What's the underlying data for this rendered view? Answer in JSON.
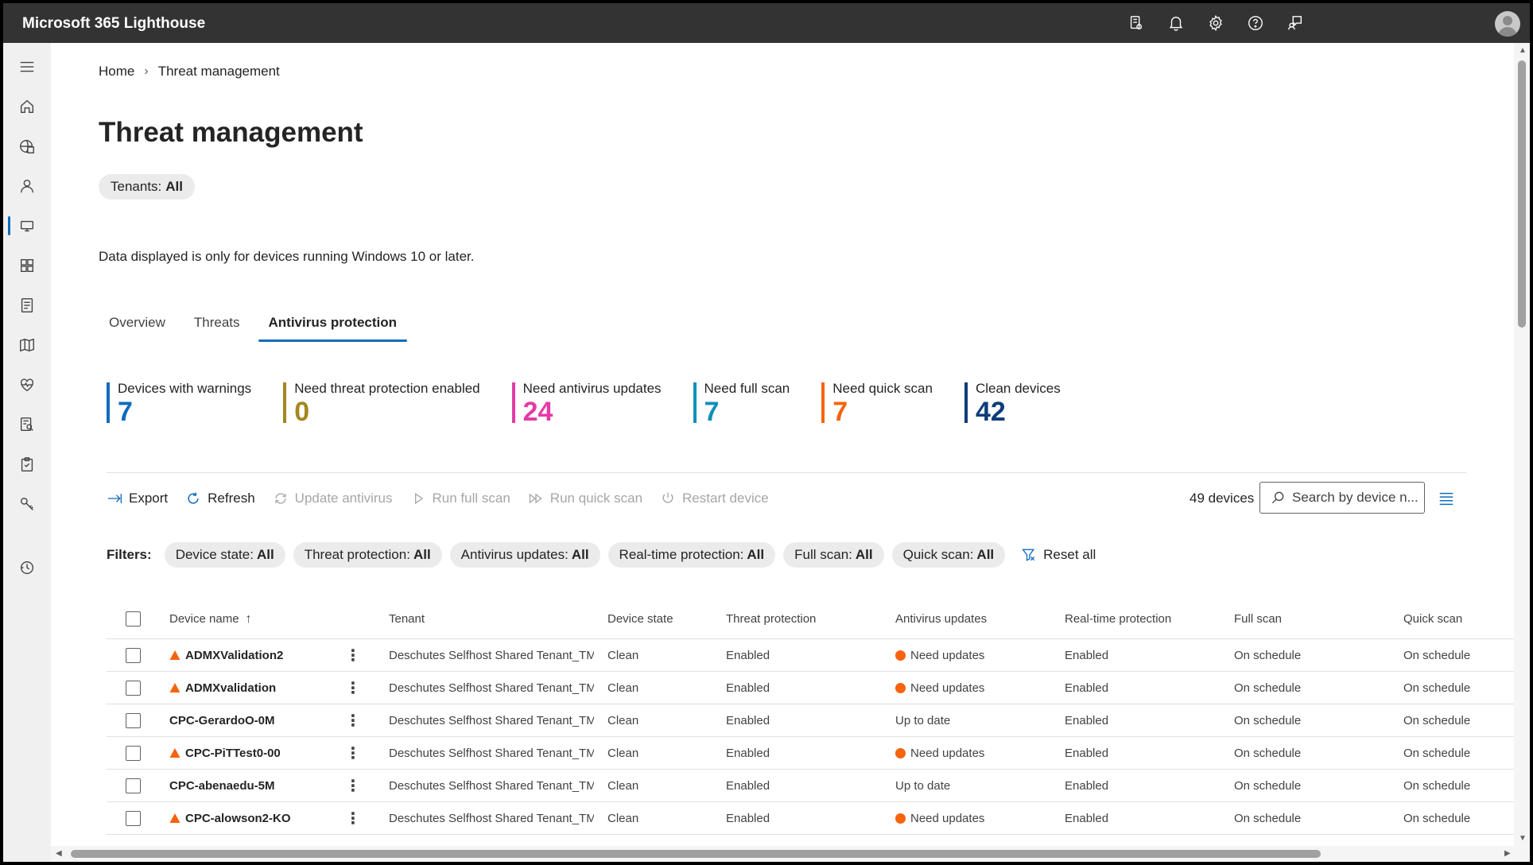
{
  "app": {
    "title": "Microsoft 365 Lighthouse"
  },
  "topbar_icons": [
    "setup-icon",
    "bell-icon",
    "gear-icon",
    "help-icon",
    "feedback-icon"
  ],
  "nav_icons": [
    "hamburger-icon",
    "home-icon",
    "tenants-icon",
    "users-icon",
    "devices-icon",
    "apps-icon",
    "policy-icon",
    "map-icon",
    "health-icon",
    "audit-icon",
    "clipboard-icon",
    "key-icon",
    "history-icon"
  ],
  "breadcrumb": {
    "home": "Home",
    "current": "Threat management"
  },
  "page": {
    "title": "Threat management",
    "tenant_label": "Tenants:",
    "tenant_value": "All",
    "notice": "Data displayed is only for devices running Windows 10 or later."
  },
  "tabs": [
    {
      "label": "Overview"
    },
    {
      "label": "Threats"
    },
    {
      "label": "Antivirus protection"
    }
  ],
  "kpis": [
    {
      "label": "Devices with warnings",
      "value": "7",
      "color": "#0f6cbd"
    },
    {
      "label": "Need threat protection enabled",
      "value": "0",
      "color": "#a4881f"
    },
    {
      "label": "Need antivirus updates",
      "value": "24",
      "color": "#e43ba6"
    },
    {
      "label": "Need full scan",
      "value": "7",
      "color": "#0f8fb8"
    },
    {
      "label": "Need quick scan",
      "value": "7",
      "color": "#f7630c"
    },
    {
      "label": "Clean devices",
      "value": "42",
      "color": "#0b3d7a"
    }
  ],
  "toolbar": {
    "export": "Export",
    "refresh": "Refresh",
    "update_antivirus": "Update antivirus",
    "run_full_scan": "Run full scan",
    "run_quick_scan": "Run quick scan",
    "restart_device": "Restart device",
    "device_count": "49 devices",
    "search_placeholder": "Search by device n..."
  },
  "filters": {
    "label": "Filters:",
    "items": [
      {
        "name": "Device state:",
        "value": "All"
      },
      {
        "name": "Threat protection:",
        "value": "All"
      },
      {
        "name": "Antivirus updates:",
        "value": "All"
      },
      {
        "name": "Real-time protection:",
        "value": "All"
      },
      {
        "name": "Full scan:",
        "value": "All"
      },
      {
        "name": "Quick scan:",
        "value": "All"
      }
    ],
    "reset": "Reset all"
  },
  "table": {
    "headers": {
      "device_name": "Device name",
      "tenant": "Tenant",
      "device_state": "Device state",
      "threat_protection": "Threat protection",
      "antivirus_updates": "Antivirus updates",
      "realtime": "Real-time protection",
      "full_scan": "Full scan",
      "quick_scan": "Quick scan"
    },
    "rows": [
      {
        "name": "ADMXValidation2",
        "warn": true,
        "tenant": "Deschutes Selfhost Shared Tenant_TM :",
        "state": "Clean",
        "threat": "Enabled",
        "av": "Need updates",
        "av_warn": true,
        "rt": "Enabled",
        "full": "On schedule",
        "quick": "On schedule"
      },
      {
        "name": "ADMXvalidation",
        "warn": true,
        "tenant": "Deschutes Selfhost Shared Tenant_TM :",
        "state": "Clean",
        "threat": "Enabled",
        "av": "Need updates",
        "av_warn": true,
        "rt": "Enabled",
        "full": "On schedule",
        "quick": "On schedule"
      },
      {
        "name": "CPC-GerardoO-0M",
        "warn": false,
        "tenant": "Deschutes Selfhost Shared Tenant_TM :",
        "state": "Clean",
        "threat": "Enabled",
        "av": "Up to date",
        "av_warn": false,
        "rt": "Enabled",
        "full": "On schedule",
        "quick": "On schedule"
      },
      {
        "name": "CPC-PiTTest0-00",
        "warn": true,
        "tenant": "Deschutes Selfhost Shared Tenant_TM :",
        "state": "Clean",
        "threat": "Enabled",
        "av": "Need updates",
        "av_warn": true,
        "rt": "Enabled",
        "full": "On schedule",
        "quick": "On schedule"
      },
      {
        "name": "CPC-abenaedu-5M",
        "warn": false,
        "tenant": "Deschutes Selfhost Shared Tenant_TM :",
        "state": "Clean",
        "threat": "Enabled",
        "av": "Up to date",
        "av_warn": false,
        "rt": "Enabled",
        "full": "On schedule",
        "quick": "On schedule"
      },
      {
        "name": "CPC-alowson2-KO",
        "warn": true,
        "tenant": "Deschutes Selfhost Shared Tenant_TM :",
        "state": "Clean",
        "threat": "Enabled",
        "av": "Need updates",
        "av_warn": true,
        "rt": "Enabled",
        "full": "On schedule",
        "quick": "On schedule"
      }
    ]
  }
}
